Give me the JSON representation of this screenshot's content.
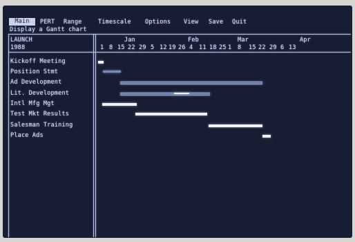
{
  "menu": {
    "items": [
      "Main",
      "PERT",
      "Range",
      "Timescale",
      "Options",
      "View",
      "Save",
      "Quit"
    ],
    "selected": "Main"
  },
  "subtitle": "Display a Gantt chart",
  "header": {
    "project_label": "LAUNCH",
    "scale_label": "1988"
  },
  "timescale": {
    "months": [
      "Jan",
      "Feb",
      "Mar",
      "Apr"
    ],
    "days": [
      "1",
      "8",
      "15",
      "22",
      "29",
      "5",
      "12",
      "19",
      "26",
      "4",
      "11",
      "18",
      "25",
      "1",
      "8",
      "15",
      "22",
      "29",
      "6",
      "13"
    ]
  },
  "tasks": [
    {
      "name": "Kickoff Meeting",
      "bar": "tiny"
    },
    {
      "name": "Position Stmt",
      "bar": "short"
    },
    {
      "name": "Ad Development",
      "bar": "long-hollow"
    },
    {
      "name": "Lit. Development",
      "bar": "mixed"
    },
    {
      "name": "Intl Mfg Mgt",
      "bar": "solid"
    },
    {
      "name": "Test Mkt Results",
      "bar": "solid"
    },
    {
      "name": "Salesman Training",
      "bar": "solid"
    },
    {
      "name": "Place Ads",
      "bar": "tiny"
    }
  ],
  "colors": {
    "screen": "#171d33",
    "text": "#dfe6ff",
    "bar": "#eef2ff"
  }
}
